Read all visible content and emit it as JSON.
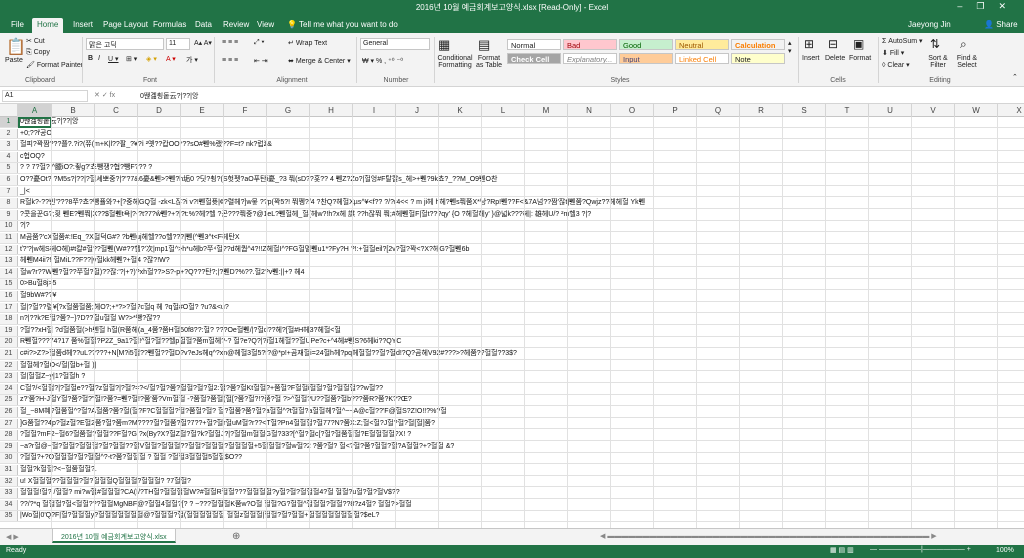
{
  "window": {
    "title": "2016년 10월 예금회계보고양식.xlsx [Read-Only] - Excel",
    "user": "Jaeyong Jin",
    "share": "Share"
  },
  "tabs": [
    "File",
    "Home",
    "Insert",
    "Page Layout",
    "Formulas",
    "Data",
    "Review",
    "View",
    "Tell me what you want to do"
  ],
  "clipboard": {
    "paste": "Paste",
    "cut": "Cut",
    "copy": "Copy",
    "format_painter": "Format Painter",
    "label": "Clipboard"
  },
  "font": {
    "name": "맑은 고딕",
    "size": "11",
    "label": "Font"
  },
  "alignment": {
    "wrap": "Wrap Text",
    "merge": "Merge & Center",
    "label": "Alignment"
  },
  "number": {
    "format": "General",
    "label": "Number"
  },
  "styles": {
    "conditional": "Conditional Formatting",
    "format_table": "Format as Table",
    "normal": "Normal",
    "bad": "Bad",
    "good": "Good",
    "neutral": "Neutral",
    "calculation": "Calculation",
    "check_cell": "Check Cell",
    "explanatory": "Explanatory...",
    "input": "Input",
    "linked_cell": "Linked Cell",
    "note": "Note",
    "label": "Styles"
  },
  "cells": {
    "insert": "Insert",
    "delete": "Delete",
    "format": "Format",
    "label": "Cells"
  },
  "editing": {
    "autosum": "AutoSum",
    "fill": "Fill",
    "clear": "Clear",
    "sort": "Sort & Filter",
    "find": "Find & Select",
    "label": "Editing"
  },
  "formula_bar": {
    "name_box": "A1",
    "content": "0뙎곎쵱둩云?|??|앙"
  },
  "columns": [
    "A",
    "B",
    "C",
    "D",
    "E",
    "F",
    "G",
    "H",
    "I",
    "J",
    "K",
    "L",
    "M",
    "N",
    "O",
    "P",
    "Q",
    "R",
    "S",
    "T",
    "U",
    "V",
    "W",
    "X",
    "Y"
  ],
  "rows": [
    {
      "n": "1",
      "t": "0뙎곎쵱둩云?|??|앙"
    },
    {
      "n": "2",
      "t": "+0;??ř공O"
    },
    {
      "n": "3",
      "t": "    헐피?꽉짬???쬴?.?i?(쮸(m+K|l??팔_?¥?ⅰ    ²옛??캅OO*??sO#쀈%랬??F=t?    nk?럽ž&"
    },
    {
      "n": "4",
      "t": "    c헙OQ?"
    },
    {
      "n": "5",
      "t": "?        ?        7?헐?     ^臘iO?:쵷g?'쵸뺑쟁?협?뺑F???    ?"
    },
    {
      "n": "6",
      "t": "O??憂Ot?  ?M5s?|??|?헐셰뽀중?|?'?7&6憂&쀈>?쀈?h垢0    ?딧?쵱?(S헛펫?aO푸탄i憂_?3    쭤(sD??홋??    4    쀈Z?Zo?|헐엉#F탈칼s_헤>+쀈?9k쵸?_??M_O9쀈O찬"
    },
    {
      "n": "7",
      "t": "_|<"
    },
    {
      "n": "8",
      "t": "R헐k?-??빈'???8쭈?쵸?뺑퓰와?+[?중헤GQ헐    -zk<L잖?i        v?!쀈헐퓻|¢?렬헤?]w뭏    ??p(꽉5?!    쭤쩽?/4    ?찬Q?헤헐Xµs^¥<f??    ?/?r4<<    ?    m    ji헤    h헤?쀈s쭤쭘X*낭?Rp!쀈??F<&7A넘??짬'잖t|쀈쭘?Qwjz??헤헤헐    Yk쀈"
    },
    {
      "n": "9",
      "t": "?콧을꾼G?;횟    쀈E?쀈쭤|X??$헐쀈t욕|?-?t?7?ŵ쀈?+?|?t:%?헤?헬    ?곤???쭤중?@1eL?쀈헐헤_헐{헤w?!h?x헤    謀    ??h잖쭤    쭤;#헤쀈헐F|헐t???qy'    {O    ?헤헐헤y'    }@넓k???헤|:    雄헤U/?    ²m헬3 ?|?"
    },
    {
      "n": "10",
      "t": "?|?"
    },
    {
      "n": "11",
      "t": "M곰쭘?'cX헐쭘#:!Eq_?X헐덕G#?    ?b쀈uj헤헬??o헬???|쀈(^쀈3^t<F헤탄X"
    },
    {
      "n": "12",
      "t": "ť?'?|w헤S헤O헤)#t칼#헐??헐쀈(W#??헬?'次|mp1헐^>h*u헤b?쭈⁴헐??d헤퀍^4?!!Z헤헐I^?FG헐멸쀈u1*?Fy?H    ?!:+헐헐eil?[2v?헐?꽉<?X?헤G?헐쀈6b"
    },
    {
      "n": "13",
      "t": "    헤쀈M4ii?!    헐MiL??F??|v헐kk헤쀈?+헐4    ?잖?!W?"
    },
    {
      "n": "14",
      "t": "헐w?r??W쀈?헐??쭈헐?헐)??잖:'?|+?)?xh헐??>S?-p+?Q???탄?;|?쀈D?%??.헐2?v쀈:||+?    헤4"
    },
    {
      "n": "15",
      "t": "0>Bu헐8j>5"
    },
    {
      "n": "16",
      "t": "헐9bW#??¥"
    },
    {
      "n": "17",
      "t": "헐|?헐??렬¥[?x헐쭘헐쭘;헤O?;+*?>?헐?c헐q    헤    ?q헐#O헐?    ?u?&<u?"
    },
    {
      "n": "18",
      "t": "n?|??k?E헐?쭘?~}?D??헐u헐헐    W?>*뺑?잖??"
    },
    {
      "n": "19",
      "t": "?헐??xH헐    ?d헐쭘헐(>h쀈헐 h헐(R쭘헤(a_4쭘?쭘H헐50f8??:헐?    ???Oe헐쀈/|?헐d??헤?[헐#H헤3?헤헐<헐"
    },
    {
      "n": "20",
      "t": "R쀈헐???74?17 쭘%헐헐?P2Z_9a1?헐!^헐?헐??헬p헐헐?쭘m헐헤?-? 헐?e?Q?|?i헐1헤헐??헐UPe?c+^4헤#쀈S?6헤ki??QYC"
    },
    {
      "n": "21",
      "t": "c#i?>Z?>헐쭘d헤??uL?????+N[M?i5헐??쀈헐??헐D?v?eJs헤q^?xn@헤헐3헐5?f?@*p!+곰재헐i=24헐h헤?pq헤헐헐??헐?헐d!?Q?곰헤V92#???>?헤쭘??헐헐??3$?"
    },
    {
      "n": "22",
      "t": "헐헐헤?헐O</헐|헐b+헐    )|"
    },
    {
      "n": "23",
      "t": "헐|헐헐Z~y|1?헐헐h    ?"
    },
    {
      "n": "24",
      "t": "C헐?/<헐헐?|?헐헐e??헐?z헐헐?|?헐?=?</헐?헐?쭘?헐헐?헐?헐2:헐?쭘?헐Kt헐헐?+쭘헐?F헐헐i헐헐?헐?헐헐헐??w헐??"
    },
    {
      "n": "25",
      "t": "z?'쭘?H-J헐Y헐?쭘?헐?\"헐!?쭘?=쀈?헐!?쭘'쭘?Vm헐헐 -?쭘헐?쭘헐(헐[?쭘?헐?!?쭘?헐 ?>^헐헐?U??헐쭘?헐b???쭘R?쭘?K??Œ?"
    },
    {
      "n": "26",
      "t": "헐_~8M혜?헐쭘헐^?헐?A헐쭘?쭘?헐(헐?F?C헐헐헐?헐?쭘헐?헐?    헐?헐쭘?쭘?헐?a헐헐^?t헐헐?a헐헐헤?헐^~~A@c헐??'F@헐S?Z!O!!?%?헐"
    },
    {
      "n": "27",
      "t": "]G쭘헐??4p?헐z헐?E헐2쭘?헐?쭘m?M????헐?헐쭘?헐?7??+헐?헐r헐uM헐?r??<T헐?Pn4헐헐헐?헐77?N?쭘X:Z;헐<헐?J헐?헐?헐[헐]쭘?"
    },
    {
      "n": "28",
      "t": "?헐헐?mF2~헐6?헐쭘헐?헐헐??F헐?G    ?x(By?X?헐Z헐?헐?k?헐헐J?|?헐헐m헐헐G헐?33?[^헐?헐c[?헐?헐쭘헐헐?E헐헐헐헐?X!    ?"
    },
    {
      "n": "29",
      "t": "~a?r헐@~헐?헐헐?헐헐헐?헐?헐헐??헐V헐헐?헐헐헐??헐헐?헐헐헐?헐헐헐헐+5헐헐헐?헐w헐?2    ?쭘?헐?    헐<?헐?쭘?헐헐?헐?A헐헐?+?헐헐    &?"
    },
    {
      "n": "30",
      "t": "?헐헐?+?O헐헐헐?헐?헐헐^?-t?쭘?헐헐헐    ?    헐헐    ?헐헐3헐헐헐5헐헐$O??"
    },
    {
      "n": "31",
      "t": "헐헐?k헐헐?<~헐쭘헐헐?."
    },
    {
      "n": "32",
      "t": "u!    Ⅹ헐헐헐??헐헐헐?헐?헐헐헐Q헐헐헐?헐헐헐?    ?7헐헐?"
    },
    {
      "n": "33",
      "t": "헐헐헐!헐?    /헐헐?    mi?w헐#헐헐헐?CA(!/?TH헐?헐헐헐헐W?#헐헐R헐헐???헐헐헐헐?y헐?헐?헐헐헐4?헐    헐헐?u헐?헐?헐V$??"
    },
    {
      "n": "34",
      "t": "??/?*q    헐헐헐?헐<헐헐???헐헐MgNBF@?헐헐4헐헐?[?    ?    ~???헐헐헐K쭘w?O헐    헐헐?G?헐헐^헐헐헐?헐헐??8?z4헐?    헐헐?>헐헐"
    },
    {
      "n": "35",
      "t": "|Wo헐|0'Q?F|헐?헐헐헐y?헐헐헐헐헐헐헐@?헐헐헐?헐(헐헐헐헐헐헐    헐헐z헐헐헐|헐헐?헐?헐헐+헐헐헐헐헐헐헐헐?$eL?"
    }
  ],
  "sheet_tab": "2016년 10월 예금회계보고양식.xlsx",
  "status": {
    "ready": "Ready",
    "zoom": "100%"
  }
}
